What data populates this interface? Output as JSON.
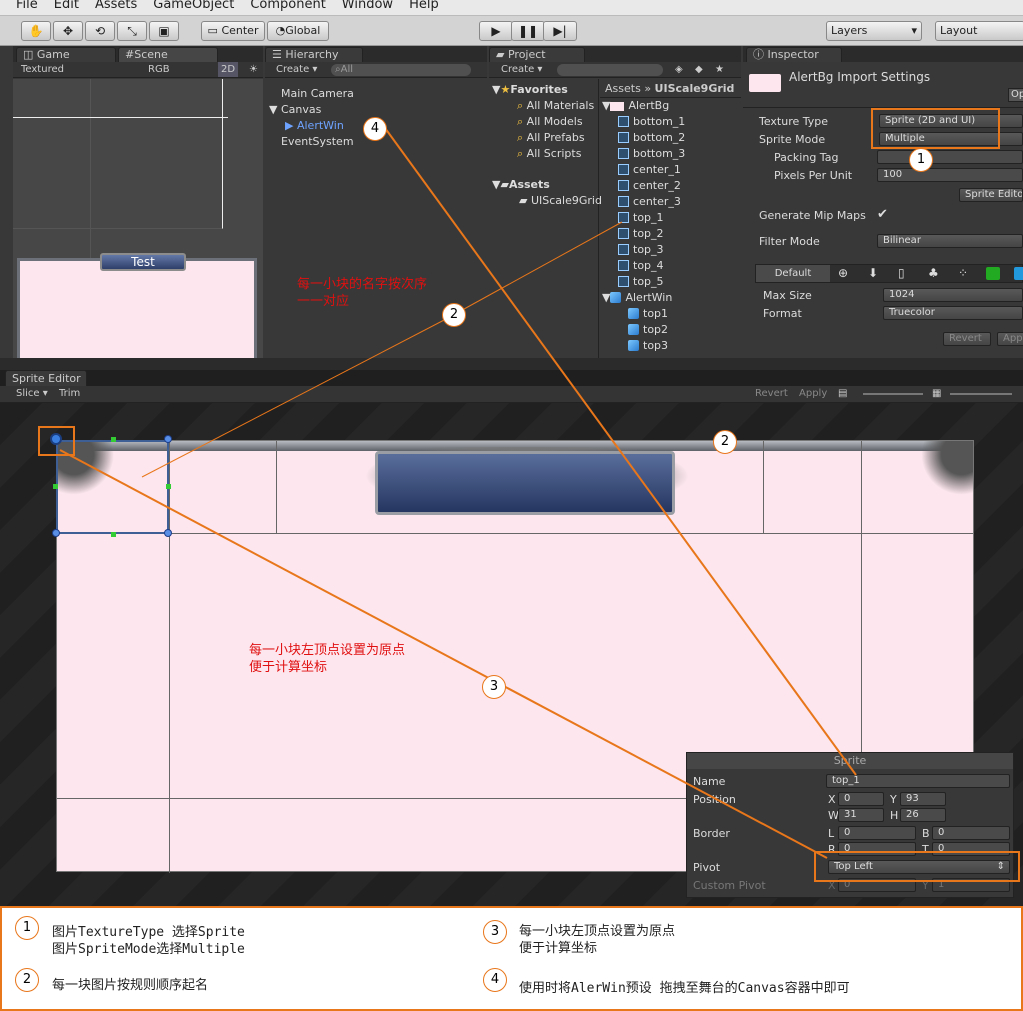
{
  "menu": [
    "File",
    "Edit",
    "Assets",
    "GameObject",
    "Component",
    "Window",
    "Help"
  ],
  "toolbar": {
    "pivot_center": "Center",
    "pivot_global": "Global",
    "layers": "Layers",
    "layout": "Layout"
  },
  "game": {
    "tab_game": "Game",
    "tab_scene": "Scene",
    "textured": "Textured",
    "rgb": "RGB",
    "mode2d": "2D",
    "test_label": "Test"
  },
  "hierarchy": {
    "tab": "Hierarchy",
    "create": "Create",
    "search_placeholder": "All",
    "items": [
      "Main Camera",
      "Canvas",
      "AlertWin",
      "EventSystem"
    ]
  },
  "project": {
    "tab": "Project",
    "create": "Create",
    "favorites": "Favorites",
    "fav_items": [
      "All Materials",
      "All Models",
      "All Prefabs",
      "All Scripts"
    ],
    "assets": "Assets",
    "asset_items": [
      "UIScale9Grid"
    ],
    "breadcrumb_root": "Assets",
    "breadcrumb_sep": "»",
    "breadcrumb_folder": "UIScale9Grid",
    "alertbg": "AlertBg",
    "sprites": [
      "bottom_1",
      "bottom_2",
      "bottom_3",
      "center_1",
      "center_2",
      "center_3",
      "top_1",
      "top_2",
      "top_3",
      "top_4",
      "top_5"
    ],
    "alertwin": "AlertWin",
    "alertwin_children": [
      "top1",
      "top2",
      "top3"
    ]
  },
  "inspector": {
    "tab": "Inspector",
    "title": "AlertBg Import Settings",
    "open": "Open",
    "texture_type_label": "Texture Type",
    "texture_type": "Sprite (2D and UI)",
    "sprite_mode_label": "Sprite Mode",
    "sprite_mode": "Multiple",
    "packing_tag_label": "Packing Tag",
    "packing_tag": "",
    "ppu_label": "Pixels Per Unit",
    "ppu": "100",
    "sprite_editor_btn": "Sprite Editor",
    "mipmaps_label": "Generate Mip Maps",
    "mipmaps": true,
    "filter_label": "Filter Mode",
    "filter": "Bilinear",
    "platform_default": "Default",
    "max_size_label": "Max Size",
    "max_size": "1024",
    "format_label": "Format",
    "format": "Truecolor",
    "revert": "Revert",
    "apply": "Apply"
  },
  "sprite_editor": {
    "tab": "Sprite Editor",
    "slice": "Slice",
    "trim": "Trim",
    "revert": "Revert",
    "apply": "Apply"
  },
  "sprite_panel": {
    "header": "Sprite",
    "name_label": "Name",
    "name": "top_1",
    "position_label": "Position",
    "x_label": "X",
    "x": "0",
    "y_label": "Y",
    "y": "93",
    "w_label": "W",
    "w": "31",
    "h_label": "H",
    "h": "26",
    "border_label": "Border",
    "l_label": "L",
    "l": "0",
    "b_label": "B",
    "b": "0",
    "r_label": "R",
    "r": "0",
    "t_label": "T",
    "t": "0",
    "pivot_label": "Pivot",
    "pivot": "Top Left",
    "custom_pivot_label": "Custom Pivot",
    "cp_x_label": "X",
    "cp_x": "0",
    "cp_y_label": "Y",
    "cp_y": "1"
  },
  "annotations": {
    "red_text_1": "每一小块的名字按次序\n一一对应",
    "red_text_2": "每一小块左顶点设置为原点\n便于计算坐标",
    "callouts": [
      "1",
      "2",
      "2",
      "3",
      "4"
    ]
  },
  "notes": [
    {
      "num": "1",
      "text": "图片TextureType  选择Sprite\n图片SpriteMode选择Multiple"
    },
    {
      "num": "2",
      "text": "每一块图片按规则顺序起名"
    },
    {
      "num": "3",
      "text": "每一小块左顶点设置为原点\n便于计算坐标"
    },
    {
      "num": "4",
      "text": "使用时将AlerWin预设  拖拽至舞台的Canvas容器中即可"
    }
  ],
  "colors": {
    "accent": "#e8761a",
    "panel_bg": "#383838",
    "sprite_pink": "#fde6ee",
    "selection_blue": "#3e5f96",
    "red_note": "#e01010"
  }
}
